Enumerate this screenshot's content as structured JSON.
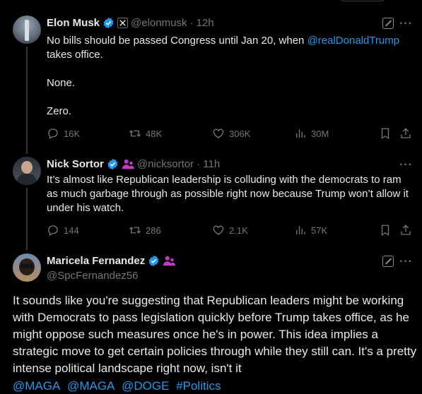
{
  "colors": {
    "background": "#000000",
    "text": "#e7e9ea",
    "muted": "#71767b",
    "link": "#1d9bf0",
    "verified": "#1d9bf0",
    "affiliate": "#c936cc"
  },
  "tweets": [
    {
      "name": "Elon Musk",
      "handle": "@elonmusk",
      "time": "· 12h",
      "verified": true,
      "badge_icon": "x-logo-icon",
      "text_pre": "No bills should be passed Congress until Jan 20, when ",
      "mention": "@realDonaldTrump",
      "text_post": " takes office.",
      "line2": "None.",
      "line3": "Zero.",
      "stats": {
        "replies": "16K",
        "reposts": "48K",
        "likes": "306K",
        "views": "30M"
      }
    },
    {
      "name": "Nick Sortor",
      "handle": "@nicksortor",
      "time": "· 11h",
      "verified": true,
      "badge_icon": "affiliate-people-icon",
      "text": "It’s almost like Republican leadership is colluding with the democrats to ram as much garbage through as possible right now because Trump won’t allow it under his watch.",
      "stats": {
        "replies": "144",
        "reposts": "286",
        "likes": "2.1K",
        "views": "57K"
      }
    }
  ],
  "main_tweet": {
    "name": "Maricela Fernandez",
    "handle": "@SpcFernandez56",
    "verified": true,
    "badge_icon": "affiliate-people-icon",
    "text": "It sounds like you're suggesting that Republican leaders might be working with Democrats to pass legislation quickly before Trump takes office, as he might oppose such measures once he's in power. This idea implies a strategic move to get certain policies through while they still can. It's a pretty intense political landscape right now, isn't it",
    "tags": [
      "@MAGA",
      "@MAGA",
      "@DOGE",
      "#Politics"
    ]
  },
  "more_label": "···"
}
